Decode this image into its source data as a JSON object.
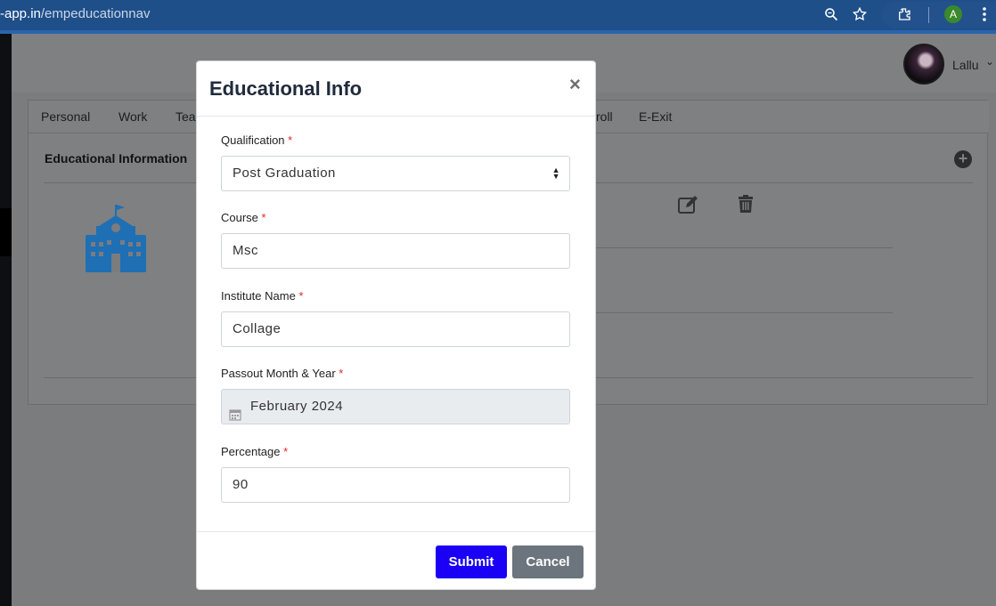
{
  "browser": {
    "url_host": "-app.in",
    "url_path": "/empeducationnav",
    "profile_initial": "A",
    "icons": [
      "zoom-icon",
      "star-icon",
      "extensions-icon",
      "menu-icon"
    ]
  },
  "app": {
    "user_name": "Lallu",
    "tabs": [
      "Personal",
      "Work",
      "Tea",
      "roll",
      "E-Exit"
    ],
    "section_title": "Educational Information"
  },
  "modal": {
    "title": "Educational Info",
    "close_symbol": "×",
    "required_marker": "*",
    "fields": {
      "qualification": {
        "label": "Qualification",
        "value": "Post Graduation"
      },
      "course": {
        "label": "Course",
        "value": "Msc"
      },
      "institute": {
        "label": "Institute Name",
        "value": "Collage"
      },
      "passout": {
        "label": "Passout Month & Year",
        "value": "February 2024"
      },
      "percentage": {
        "label": "Percentage",
        "value": "90"
      }
    },
    "submit_label": "Submit",
    "cancel_label": "Cancel"
  },
  "colors": {
    "submit": "#1a00f5",
    "cancel": "#6c757d",
    "required": "#e0242b",
    "school_icon": "#1f6fb5"
  }
}
